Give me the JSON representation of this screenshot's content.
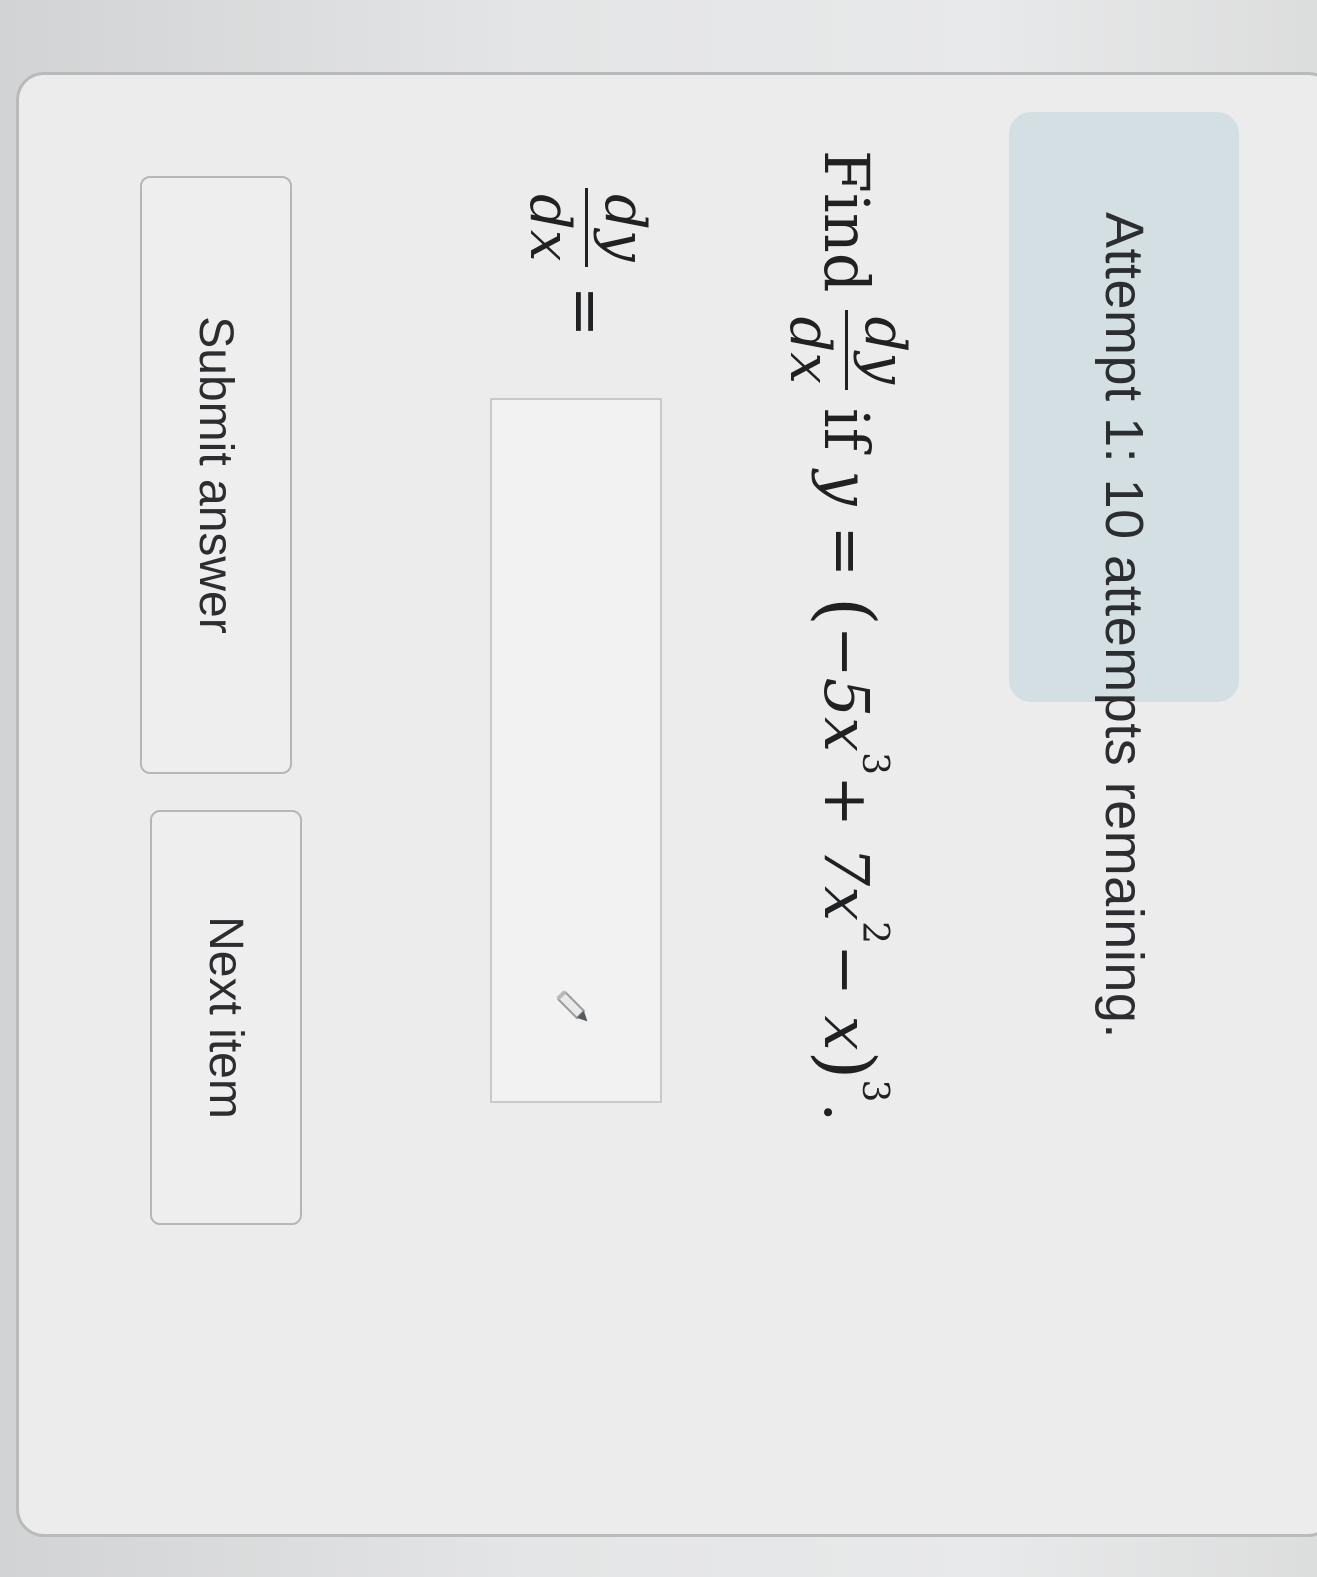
{
  "banner": {
    "attempts_text": "Attempt 1: 10 attempts remaining."
  },
  "question": {
    "find_word": "Find",
    "frac_num": "dy",
    "frac_den": "dx",
    "if_word": "if",
    "expr_lhs": "y = ",
    "open_paren": "(",
    "term1": "−5x",
    "term1_exp": "3",
    "term2": " + 7x",
    "term2_exp": "2",
    "term3": " − x",
    "close_paren": ")",
    "outer_exp": "3",
    "period": "."
  },
  "answer": {
    "lhs_num": "dy",
    "lhs_den": "dx",
    "equals": " =",
    "value": "",
    "placeholder": ""
  },
  "buttons": {
    "submit_label": "Submit answer",
    "next_label": "Next item"
  },
  "icons": {
    "pencil": "pencil-icon"
  }
}
